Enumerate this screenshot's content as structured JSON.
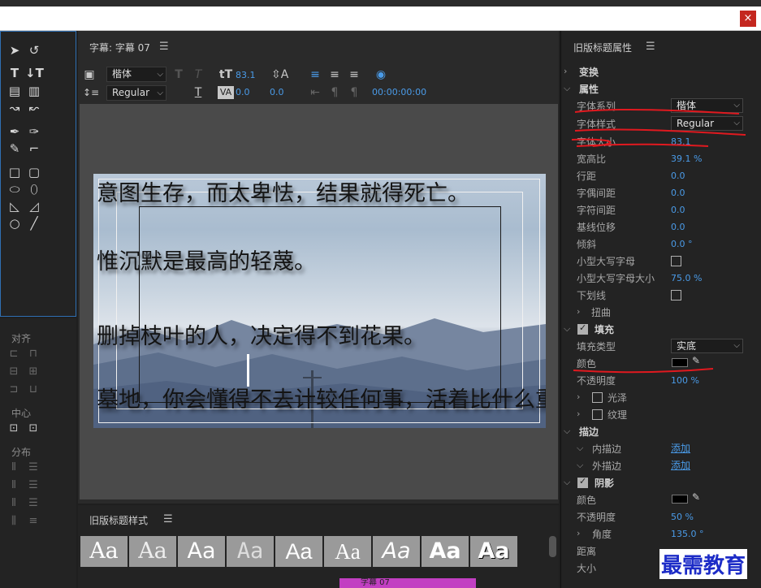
{
  "window": {
    "close_label": "×"
  },
  "editor": {
    "title": "字幕: 字幕 07",
    "font_family": "楷体",
    "font_style": "Regular",
    "font_size": "83.1",
    "kerning": "0.0",
    "leading": "0.0",
    "timecode": "00:00:00:00",
    "lines": [
      "意图生存，而太卑怯，结果就得死亡。",
      "惟沉默是最高的轻蔑。",
      "删掉枝叶的人，决定得不到花果。",
      "墓地，你会懂得不去计较任何事，活着比什么重要。"
    ]
  },
  "tools_panel": {
    "align_title": "对齐",
    "center_title": "中心",
    "distribute_title": "分布"
  },
  "styles": {
    "title": "旧版标题样式",
    "swatch_text": "Aa"
  },
  "props": {
    "title": "旧版标题属性",
    "transform": "变换",
    "properties": "属性",
    "font_family_label": "字体系列",
    "font_family_value": "楷体",
    "font_style_label": "字体样式",
    "font_style_value": "Regular",
    "font_size_label": "字体大小",
    "font_size_value": "83.1",
    "aspect_label": "宽高比",
    "aspect_value": "39.1 %",
    "leading_label": "行距",
    "leading_value": "0.0",
    "kerning_label": "字偶间距",
    "kerning_value": "0.0",
    "tracking_label": "字符间距",
    "tracking_value": "0.0",
    "baseline_label": "基线位移",
    "baseline_value": "0.0",
    "slant_label": "倾斜",
    "slant_value": "0.0 °",
    "smallcaps_label": "小型大写字母",
    "smallcaps_size_label": "小型大写字母大小",
    "smallcaps_size_value": "75.0 %",
    "underline_label": "下划线",
    "distort_label": "扭曲",
    "fill_label": "填充",
    "fill_type_label": "填充类型",
    "fill_type_value": "实底",
    "color_label": "颜色",
    "opacity_label": "不透明度",
    "opacity_value": "100 %",
    "sheen_label": "光泽",
    "texture_label": "纹理",
    "stroke_label": "描边",
    "inner_stroke_label": "内描边",
    "outer_stroke_label": "外描边",
    "add_label": "添加",
    "shadow_label": "阴影",
    "shadow_color_label": "颜色",
    "shadow_opacity_label": "不透明度",
    "shadow_opacity_value": "50 %",
    "angle_label": "角度",
    "angle_value": "135.0 °",
    "distance_label": "距离",
    "size_label": "大小"
  },
  "watermark": "最需教育",
  "timeline_clip": "字幕 07",
  "colors": {
    "accent": "#4a9be8",
    "annotation": "#e0191f",
    "clip": "#c23fc2",
    "watermark": "#1d2cc7"
  }
}
